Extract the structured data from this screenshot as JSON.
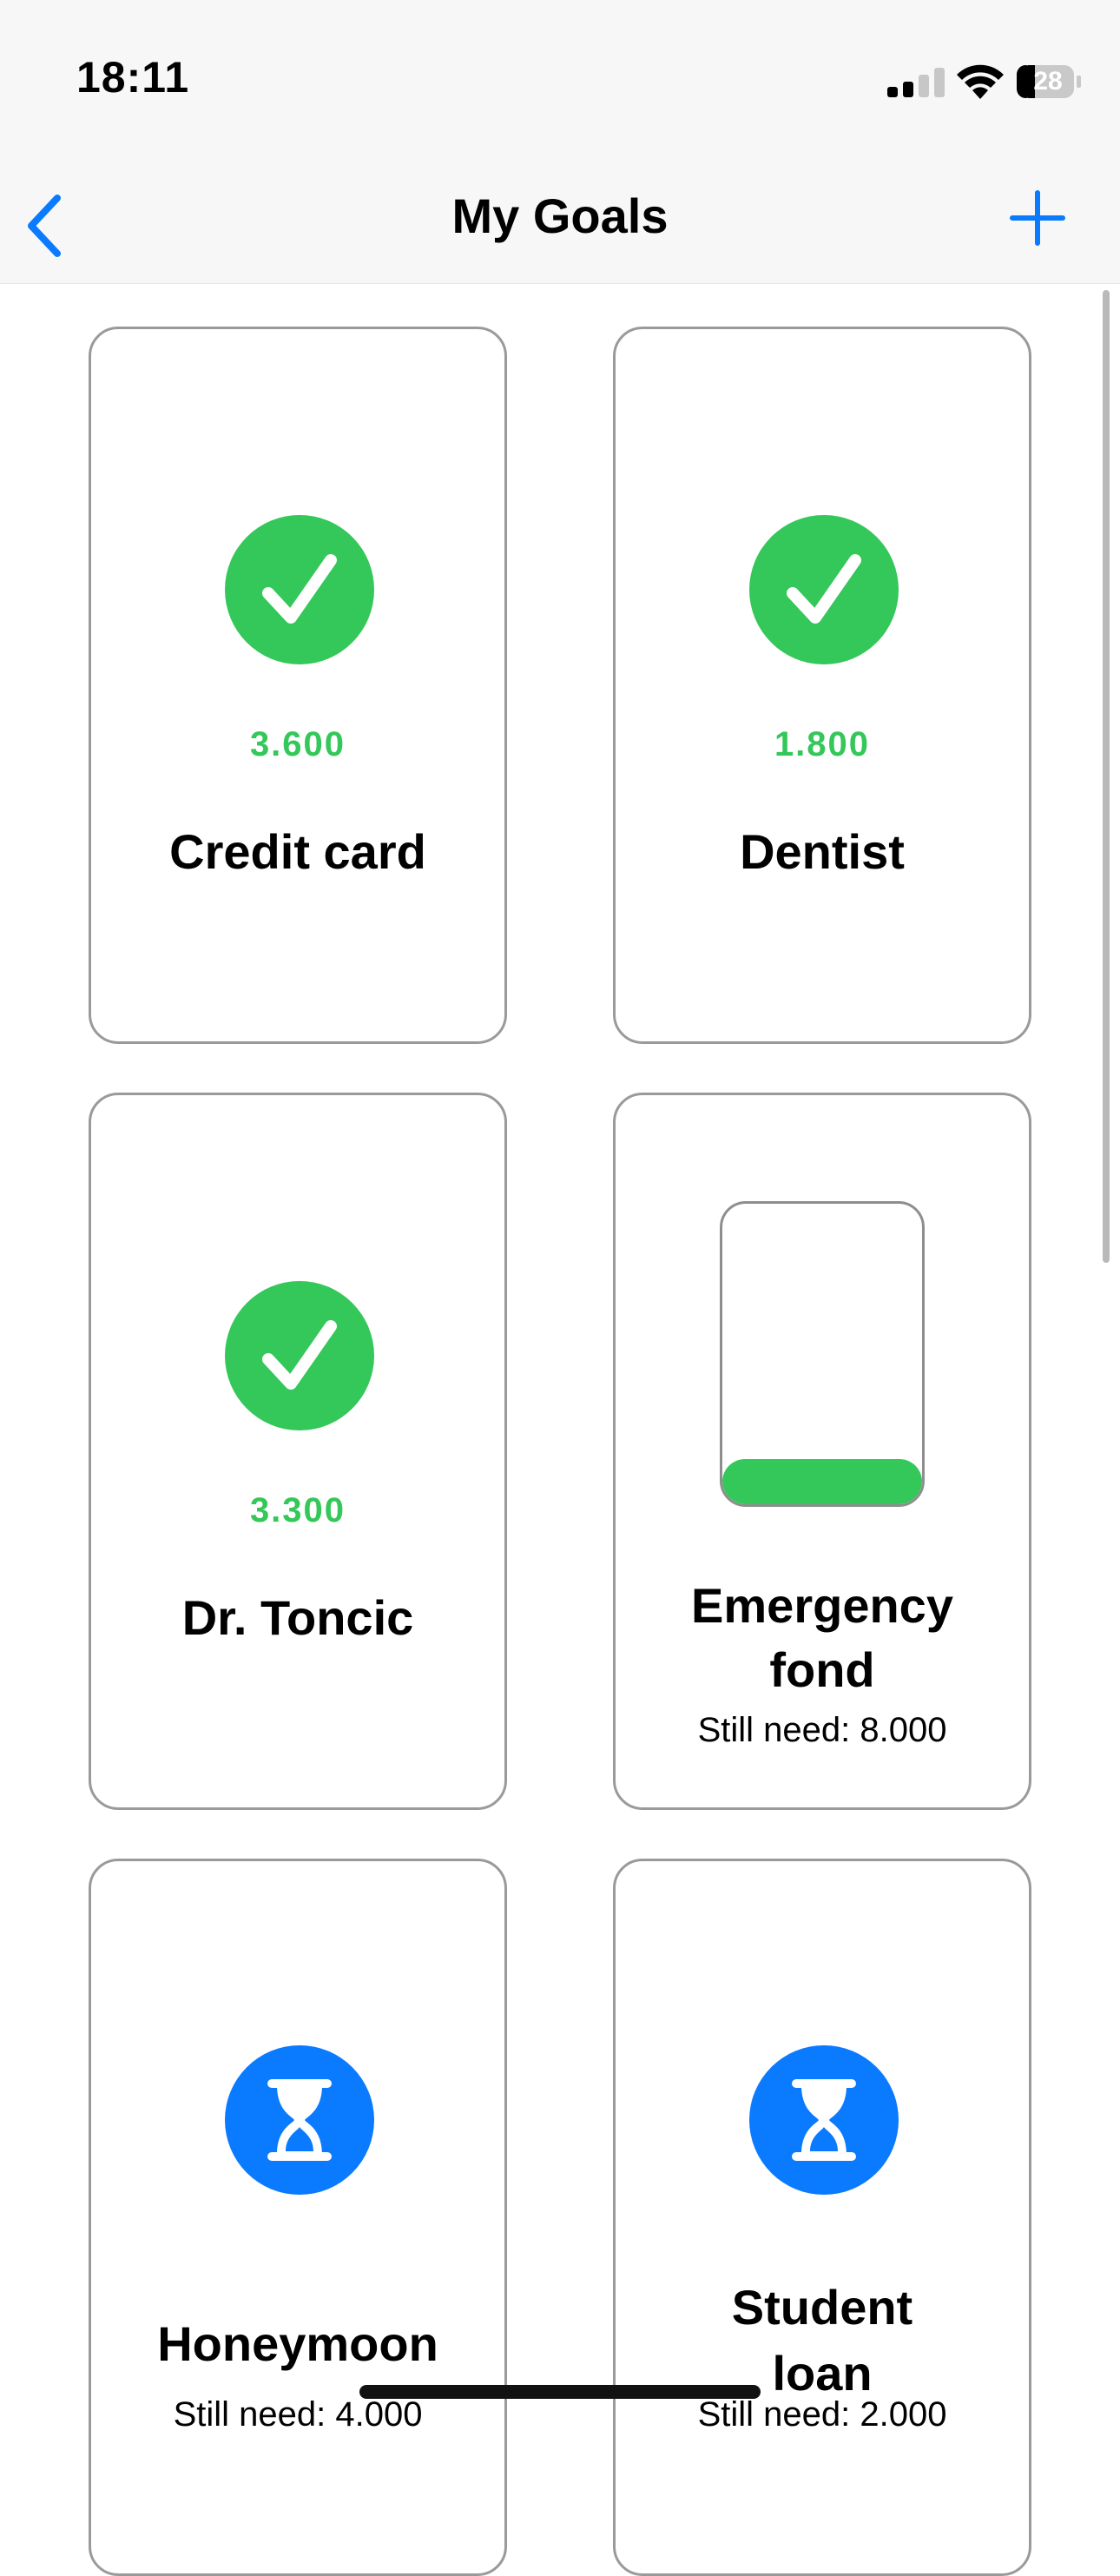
{
  "status_bar": {
    "time": "18:11",
    "battery": "28"
  },
  "nav": {
    "title": "My Goals",
    "back_icon": "chevron-left-icon",
    "add_icon": "plus-icon"
  },
  "colors": {
    "accent": "#0a7aff",
    "complete": "#34c759",
    "card_border": "#9a9a9a"
  },
  "goals": [
    {
      "title": "Credit card",
      "amount": "3.600",
      "status": "completed",
      "icon": "checkmark-circle-icon"
    },
    {
      "title": "Dentist",
      "amount": "1.800",
      "status": "completed",
      "icon": "checkmark-circle-icon"
    },
    {
      "title": "Dr. Toncic",
      "amount": "3.300",
      "status": "completed",
      "icon": "checkmark-circle-icon"
    },
    {
      "title": "Emergency fond",
      "title_line1": "Emergency",
      "title_line2": "fond",
      "remaining": "Still need: 8.000",
      "status": "in-progress",
      "icon": "jar-progress-icon",
      "progress": 0.15
    },
    {
      "title": "Honeymoon",
      "remaining": "Still need: 4.000",
      "status": "pending",
      "icon": "hourglass-icon"
    },
    {
      "title": "Student loan",
      "title_line1": "Student",
      "title_line2": "loan",
      "remaining": "Still need: 2.000",
      "status": "pending",
      "icon": "hourglass-icon"
    }
  ]
}
